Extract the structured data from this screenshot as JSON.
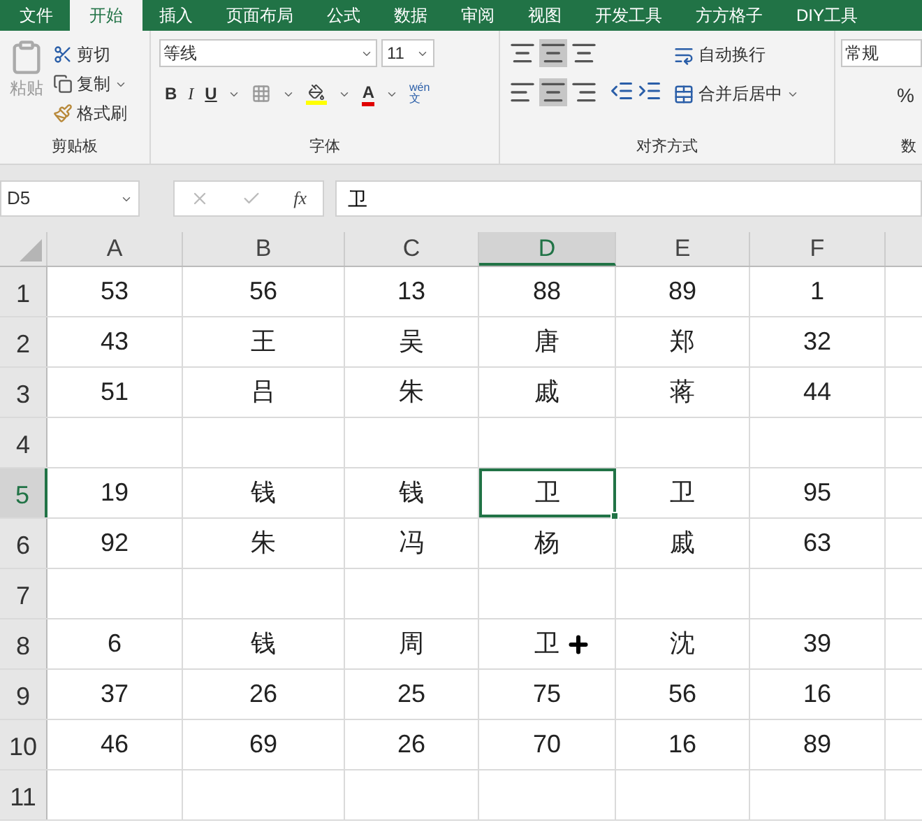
{
  "tabs": [
    {
      "label": "文件",
      "selected": false
    },
    {
      "label": "开始",
      "selected": true
    },
    {
      "label": "插入",
      "selected": false
    },
    {
      "label": "页面布局",
      "selected": false
    },
    {
      "label": "公式",
      "selected": false
    },
    {
      "label": "数据",
      "selected": false
    },
    {
      "label": "审阅",
      "selected": false
    },
    {
      "label": "视图",
      "selected": false
    },
    {
      "label": "开发工具",
      "selected": false
    },
    {
      "label": "方方格子",
      "selected": false
    },
    {
      "label": "DIY工具",
      "selected": false
    }
  ],
  "clipboard": {
    "paste": "粘贴",
    "cut": "剪切",
    "copy": "复制",
    "format_painter": "格式刷",
    "group": "剪贴板"
  },
  "font": {
    "name": "等线",
    "size": "11",
    "bold": "B",
    "italic": "I",
    "underline": "U",
    "group": "字体",
    "font_color": "A",
    "phonetic_top": "wén",
    "phonetic_bottom": "文"
  },
  "alignment": {
    "wrap": "自动换行",
    "merge": "合并后居中",
    "group": "对齐方式"
  },
  "number": {
    "format": "常规",
    "percent": "%",
    "group": "数"
  },
  "formula_bar": {
    "name_box": "D5",
    "function": "fx",
    "value": "卫"
  },
  "columns": [
    {
      "label": "A",
      "selected": false
    },
    {
      "label": "B",
      "selected": false
    },
    {
      "label": "C",
      "selected": false
    },
    {
      "label": "D",
      "selected": true
    },
    {
      "label": "E",
      "selected": false
    },
    {
      "label": "F",
      "selected": false
    }
  ],
  "rows": [
    {
      "label": "1",
      "selected": false,
      "cells": [
        "53",
        "56",
        "13",
        "88",
        "89",
        "1"
      ]
    },
    {
      "label": "2",
      "selected": false,
      "cells": [
        "43",
        "王",
        "吴",
        "唐",
        "郑",
        "32"
      ]
    },
    {
      "label": "3",
      "selected": false,
      "cells": [
        "51",
        "吕",
        "朱",
        "戚",
        "蒋",
        "44"
      ]
    },
    {
      "label": "4",
      "selected": false,
      "cells": [
        "",
        "",
        "",
        "",
        "",
        ""
      ]
    },
    {
      "label": "5",
      "selected": true,
      "cells": [
        "19",
        "钱",
        "钱",
        {
          "text": "卫",
          "selected": true
        },
        "卫",
        "95"
      ]
    },
    {
      "label": "6",
      "selected": false,
      "cells": [
        "92",
        "朱",
        "冯",
        "杨",
        "戚",
        "63"
      ]
    },
    {
      "label": "7",
      "selected": false,
      "cells": [
        "",
        "",
        "",
        "",
        "",
        ""
      ]
    },
    {
      "label": "8",
      "selected": false,
      "cells": [
        "6",
        "钱",
        "周",
        {
          "text": "卫",
          "cursor": true
        },
        "沈",
        "39"
      ]
    },
    {
      "label": "9",
      "selected": false,
      "cells": [
        "37",
        "26",
        "25",
        "75",
        "56",
        "16"
      ]
    },
    {
      "label": "10",
      "selected": false,
      "cells": [
        "46",
        "69",
        "26",
        "70",
        "16",
        "89"
      ]
    },
    {
      "label": "11",
      "selected": false,
      "cells": [
        "",
        "",
        "",
        "",
        "",
        ""
      ]
    }
  ]
}
